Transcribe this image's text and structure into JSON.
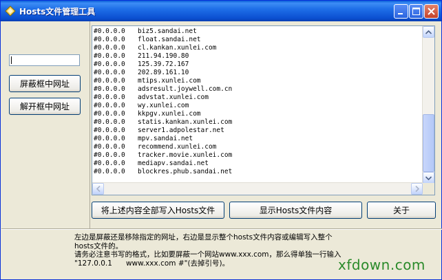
{
  "window": {
    "title": "Hosts文件管理工具"
  },
  "left_panel": {
    "input_value": "",
    "block_button": "屏蔽框中网址",
    "unblock_button": "解开框中网址"
  },
  "hosts_lines": [
    {
      "ip": "#0.0.0.0",
      "host": "biz5.sandai.net"
    },
    {
      "ip": "#0.0.0.0",
      "host": "float.sandai.net"
    },
    {
      "ip": "#0.0.0.0",
      "host": "cl.kankan.xunlei.com"
    },
    {
      "ip": "#0.0.0.0",
      "host": "211.94.190.80"
    },
    {
      "ip": "#0.0.0.0",
      "host": "125.39.72.167"
    },
    {
      "ip": "#0.0.0.0",
      "host": "202.89.161.10"
    },
    {
      "ip": "#0.0.0.0",
      "host": "mtips.xunlei.com"
    },
    {
      "ip": "#0.0.0.0",
      "host": "adsresult.joywell.com.cn"
    },
    {
      "ip": "#0.0.0.0",
      "host": "advstat.xunlei.com"
    },
    {
      "ip": "#0.0.0.0",
      "host": "wy.xunlei.com"
    },
    {
      "ip": "#0.0.0.0",
      "host": "kkpgv.xunlei.com"
    },
    {
      "ip": "#0.0.0.0",
      "host": "statis.kankan.xunlei.com"
    },
    {
      "ip": "#0.0.0.0",
      "host": "server1.adpolestar.net"
    },
    {
      "ip": "#0.0.0.0",
      "host": "mpv.sandai.net"
    },
    {
      "ip": "#0.0.0.0",
      "host": "recommend.xunlei.com"
    },
    {
      "ip": "#0.0.0.0",
      "host": "tracker.movie.xunlei.com"
    },
    {
      "ip": "#0.0.0.0",
      "host": "mediapv.sandai.net"
    },
    {
      "ip": "#0.0.0.0",
      "host": "blockres.phub.sandai.net"
    }
  ],
  "buttons": {
    "write_hosts": "将上述内容全部写入Hosts文件",
    "show_hosts": "显示Hosts文件内容",
    "about": "关于"
  },
  "hint": {
    "line1": "左边是屏蔽还是移除指定的网址，右边是显示整个hosts文件内容或编辑写入整个",
    "line2": "hosts文件的。",
    "line3": "请务必注意书写的格式，比如要屏蔽一个网站www.xxx.com，那么得单独一行输入",
    "line4": "\"127.0.0.1      www.xxx.com #\"(去掉引号)。"
  },
  "watermark": "xfdown.com"
}
